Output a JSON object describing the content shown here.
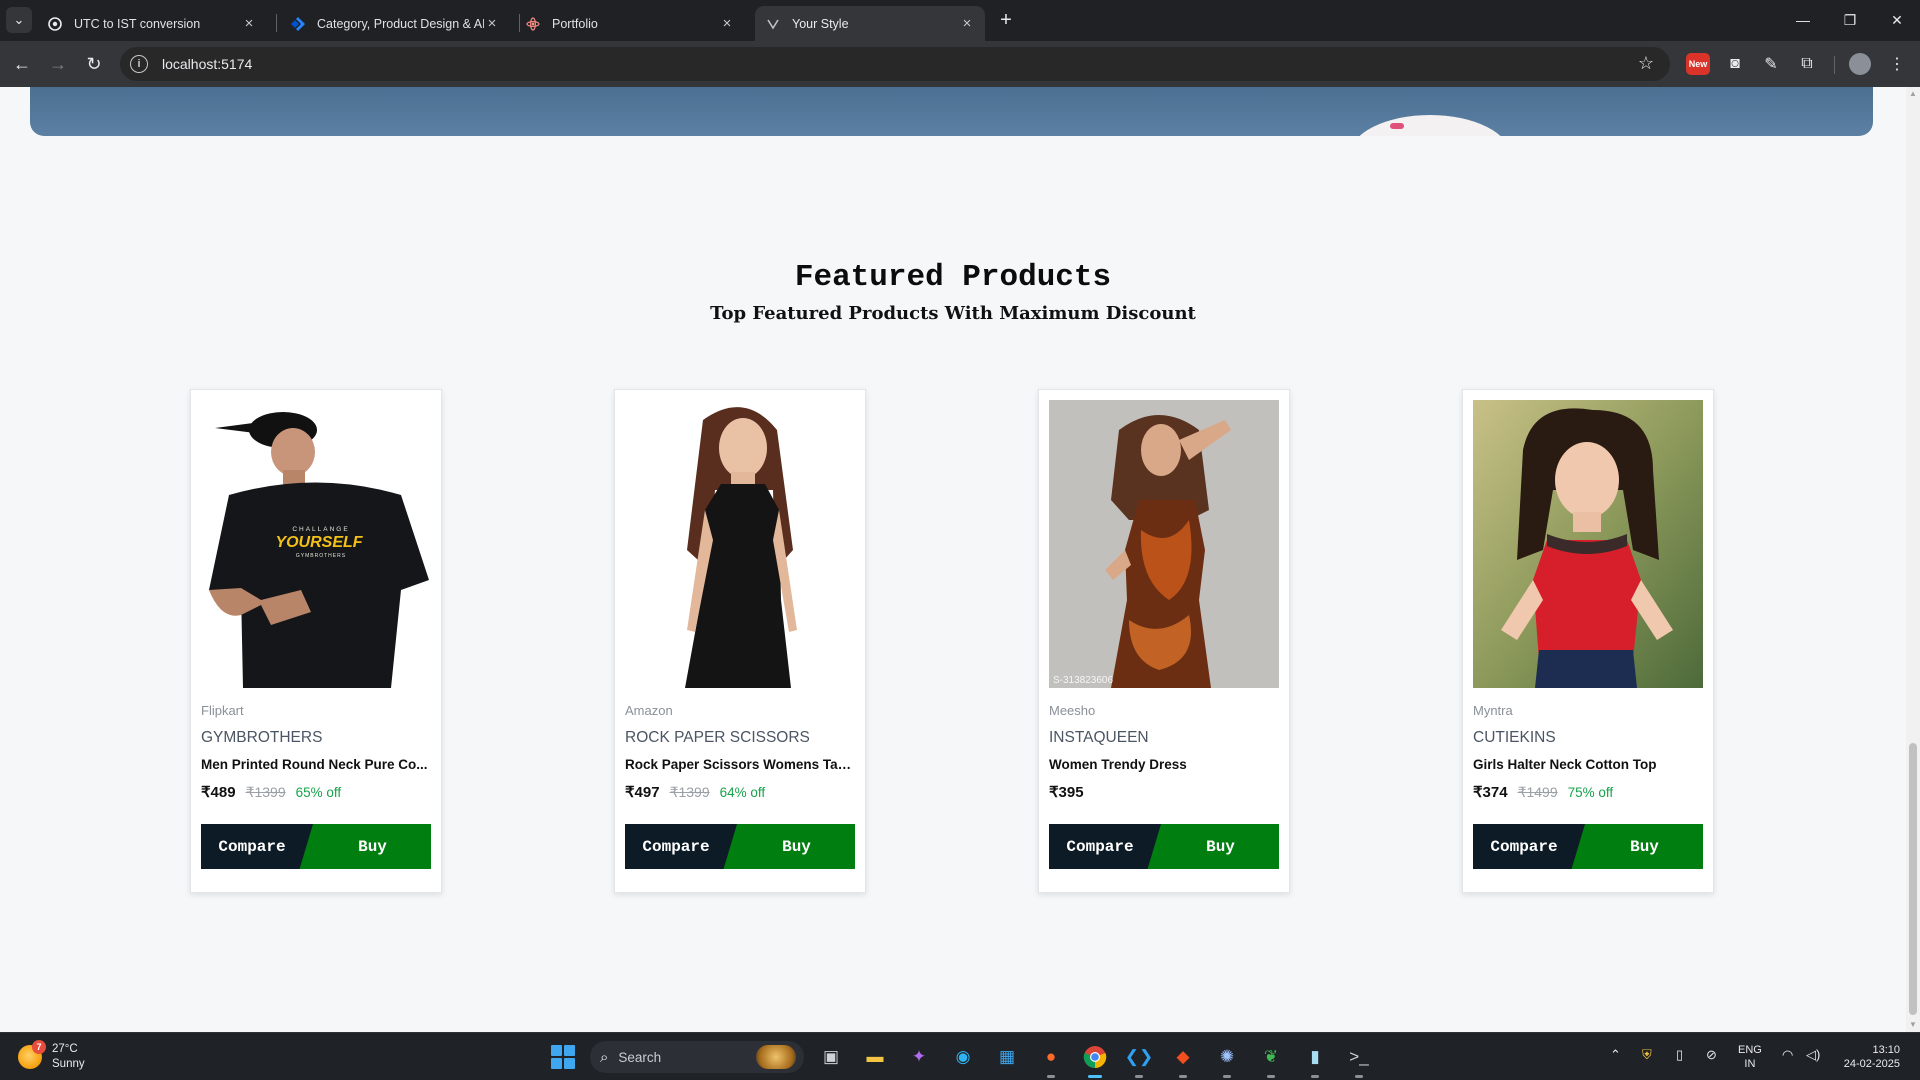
{
  "browser": {
    "tabs": [
      {
        "title": "UTC to IST conversion",
        "favicon": "chatgpt-icon"
      },
      {
        "title": "Category, Product Design & AP",
        "favicon": "jira-icon"
      },
      {
        "title": "Portfolio",
        "favicon": "react-icon"
      },
      {
        "title": "Your Style",
        "favicon": "site-icon"
      }
    ],
    "active_tab_index": 3,
    "url": "localhost:5174",
    "ext_new_label": "New"
  },
  "page": {
    "section_title": "Featured Products",
    "section_subtitle": "Top Featured Products With Maximum Discount",
    "compare_label": "Compare",
    "buy_label": "Buy",
    "products": [
      {
        "store": "Flipkart",
        "brand": "GYMBROTHERS",
        "name": "Men Printed Round Neck Pure Co...",
        "price": "₹489",
        "mrp": "₹1399",
        "discount": "65% off",
        "shirt_line1": "CHALLANGE",
        "shirt_line2": "YOURSELF",
        "shirt_line3": "GYMBROTHERS"
      },
      {
        "store": "Amazon",
        "brand": "ROCK PAPER SCISSORS",
        "name": "Rock Paper Scissors Womens Tan...",
        "price": "₹497",
        "mrp": "₹1399",
        "discount": "64% off"
      },
      {
        "store": "Meesho",
        "brand": "INSTAQUEEN",
        "name": "Women Trendy Dress",
        "price": "₹395",
        "mrp": "",
        "discount": "",
        "watermark": "S-313823606"
      },
      {
        "store": "Myntra",
        "brand": "CUTIEKINS",
        "name": "Girls Halter Neck Cotton Top",
        "price": "₹374",
        "mrp": "₹1499",
        "discount": "75% off"
      }
    ]
  },
  "taskbar": {
    "weather_temp": "27°C",
    "weather_desc": "Sunny",
    "weather_badge": "7",
    "search_placeholder": "Search",
    "lang_line1": "ENG",
    "lang_line2": "IN",
    "time": "13:10",
    "date": "24-02-2025"
  },
  "colors": {
    "compare_bg": "#0d1b26",
    "buy_bg": "#007e0f",
    "discount": "#16a34a",
    "hero": "#5b80a3"
  }
}
